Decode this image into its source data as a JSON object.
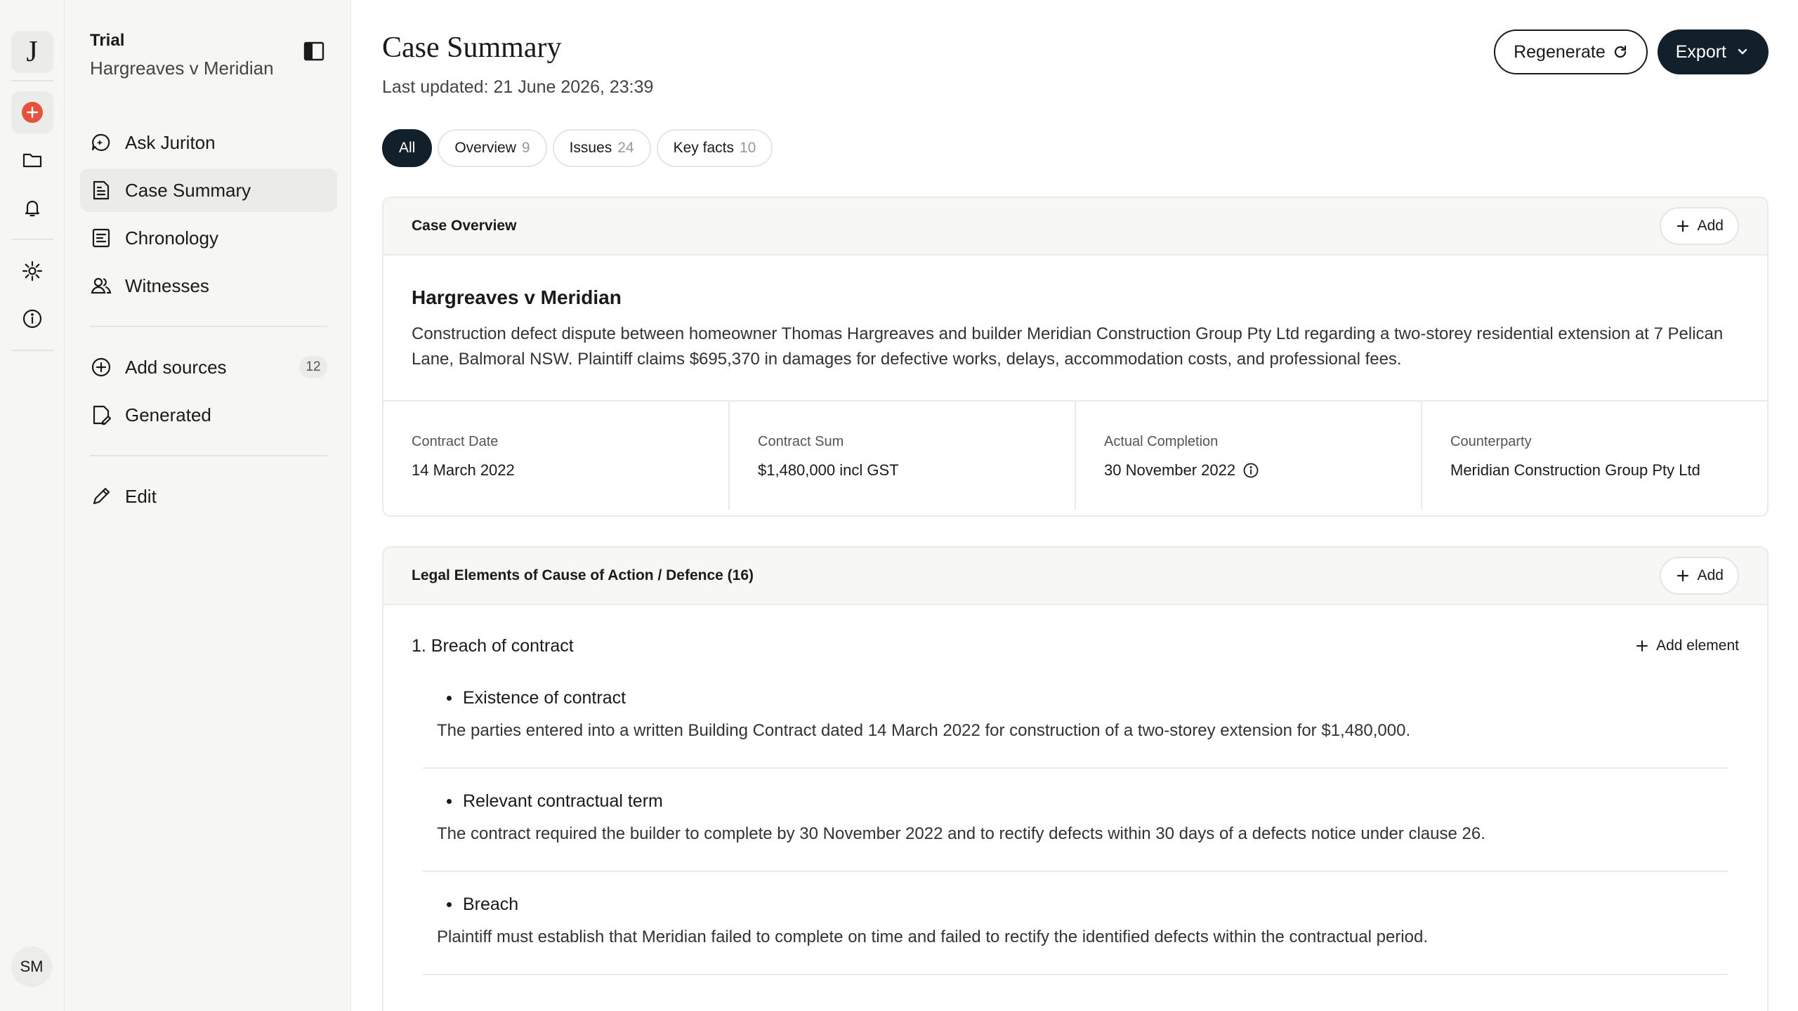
{
  "rail": {
    "logo": "J",
    "avatar": "SM",
    "colors": {
      "new": "#e5533d"
    },
    "icons": [
      "new-case-icon",
      "folder-icon",
      "bell-icon",
      "gear-icon",
      "info-icon"
    ]
  },
  "sidebar": {
    "title": "Trial",
    "subtitle": "Hargreaves v Meridian",
    "nav": [
      {
        "label": "Ask Juriton",
        "icon": "chat-sparkle-icon"
      },
      {
        "label": "Case Summary",
        "icon": "document-icon",
        "active": true
      },
      {
        "label": "Chronology",
        "icon": "timeline-icon"
      },
      {
        "label": "Witnesses",
        "icon": "people-icon"
      }
    ],
    "sources": {
      "label": "Add sources",
      "count": "12"
    },
    "generated": {
      "label": "Generated"
    },
    "edit": {
      "label": "Edit"
    }
  },
  "page": {
    "title": "Case Summary",
    "updated": "Last updated: 21 June 2026, 23:39",
    "regenerate_label": "Regenerate",
    "export_label": "Export"
  },
  "filters": [
    {
      "label": "All",
      "count": "",
      "active": true
    },
    {
      "label": "Overview",
      "count": "9"
    },
    {
      "label": "Issues",
      "count": "24"
    },
    {
      "label": "Key facts",
      "count": "10"
    }
  ],
  "overview": {
    "header": "Case Overview",
    "add_label": "Add",
    "case_name": "Hargreaves v Meridian",
    "description": "Construction defect dispute between homeowner Thomas Hargreaves and builder Meridian Construction Group Pty Ltd regarding a two-storey residential extension at 7 Pelican Lane, Balmoral NSW. Plaintiff claims $695,370 in damages for defective works, delays, accommodation costs, and professional fees.",
    "facts": [
      {
        "label": "Contract Date",
        "value": "14 March 2022"
      },
      {
        "label": "Contract Sum",
        "value": "$1,480,000 incl GST"
      },
      {
        "label": "Actual Completion",
        "value": "30 November 2022"
      },
      {
        "label": "Counterparty",
        "value": "Meridian Construction Group Pty Ltd"
      }
    ]
  },
  "legal": {
    "header": "Legal Elements of Cause of Action / Defence (16)",
    "add_label": "Add",
    "section_title": "1. Breach of contract",
    "add_element_label": "Add element",
    "items": [
      {
        "title": "Existence of contract",
        "desc": "The parties entered into a written Building Contract dated 14 March 2022 for construction of a two-storey extension for $1,480,000."
      },
      {
        "title": "Relevant contractual term",
        "desc": "The contract required the builder to complete by 30 November 2022 and to rectify defects within 30 days of a defects notice under clause 26."
      },
      {
        "title": "Breach",
        "desc": "Plaintiff must establish that Meridian failed to complete on time and failed to rectify the identified defects within the contractual period."
      }
    ]
  }
}
